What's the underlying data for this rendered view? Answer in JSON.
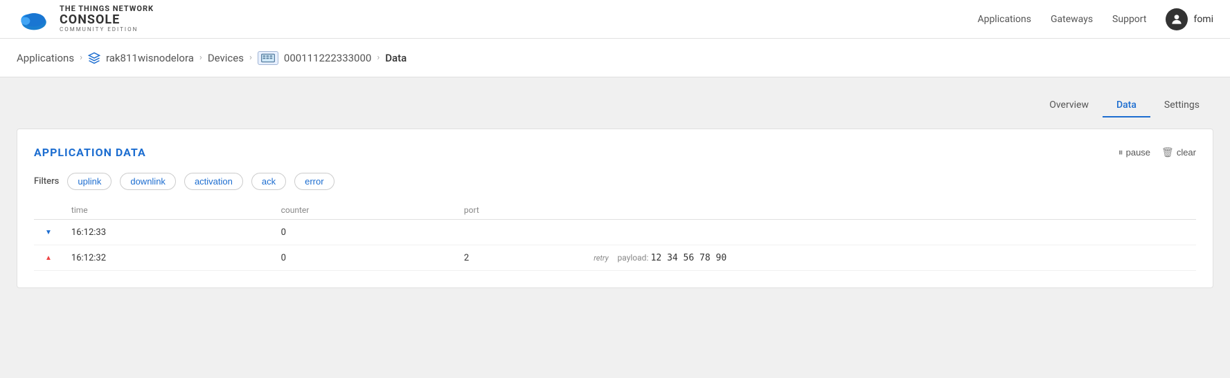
{
  "header": {
    "logo": {
      "network_label": "THE THINGS NETWORK",
      "console_label": "CONSOLE",
      "edition_label": "COMMUNITY EDITION"
    },
    "nav": {
      "applications": "Applications",
      "gateways": "Gateways",
      "support": "Support"
    },
    "user": {
      "name": "fomi",
      "avatar_icon": "👤"
    }
  },
  "breadcrumb": {
    "items": [
      {
        "label": "Applications",
        "href": "#"
      },
      {
        "sep": ">"
      },
      {
        "label": "rak811wisnodelora",
        "href": "#",
        "has_icon": true
      },
      {
        "sep": ">"
      },
      {
        "label": "Devices",
        "href": "#"
      },
      {
        "sep": ">"
      },
      {
        "label": "000111222333000",
        "href": "#",
        "has_device_icon": true
      },
      {
        "sep": ">"
      },
      {
        "label": "Data",
        "current": true
      }
    ]
  },
  "tabs": [
    {
      "label": "Overview",
      "active": false
    },
    {
      "label": "Data",
      "active": true
    },
    {
      "label": "Settings",
      "active": false
    }
  ],
  "application_data": {
    "title": "APPLICATION DATA",
    "pause_label": "pause",
    "clear_label": "clear",
    "filters_label": "Filters",
    "filters": [
      "uplink",
      "downlink",
      "activation",
      "ack",
      "error"
    ],
    "table": {
      "columns": [
        "time",
        "counter",
        "port"
      ],
      "rows": [
        {
          "direction": "down",
          "time": "16:12:33",
          "counter": "0",
          "port": "",
          "retry": "",
          "has_payload": false,
          "payload": ""
        },
        {
          "direction": "up",
          "time": "16:12:32",
          "counter": "0",
          "port": "2",
          "retry": "retry",
          "has_payload": true,
          "payload_label": "payload:",
          "payload": "12 34 56 78 90"
        }
      ]
    }
  }
}
